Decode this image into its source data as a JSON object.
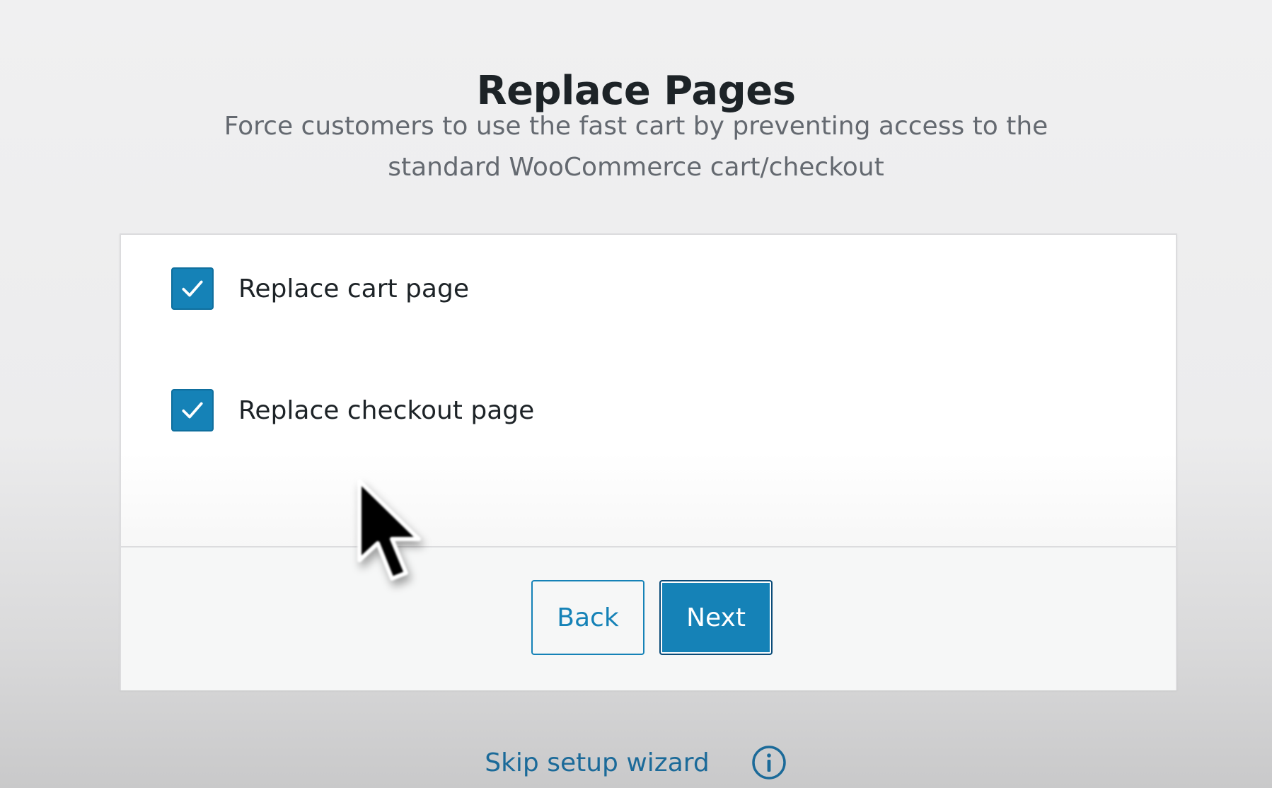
{
  "header": {
    "title": "Replace Pages",
    "subtitle": "Force customers to use the fast cart by preventing access to the standard WooCommerce cart/checkout"
  },
  "options": [
    {
      "label": "Replace cart page",
      "checked": true
    },
    {
      "label": "Replace checkout page",
      "checked": true
    }
  ],
  "buttons": {
    "back_label": "Back",
    "next_label": "Next"
  },
  "footer": {
    "skip_label": "Skip setup wizard",
    "info_icon": "info-icon"
  },
  "colors": {
    "accent": "#1582b7",
    "accent_dark": "#0a4b78",
    "link": "#1b6a99",
    "text": "#1d2327",
    "muted": "#646970"
  }
}
